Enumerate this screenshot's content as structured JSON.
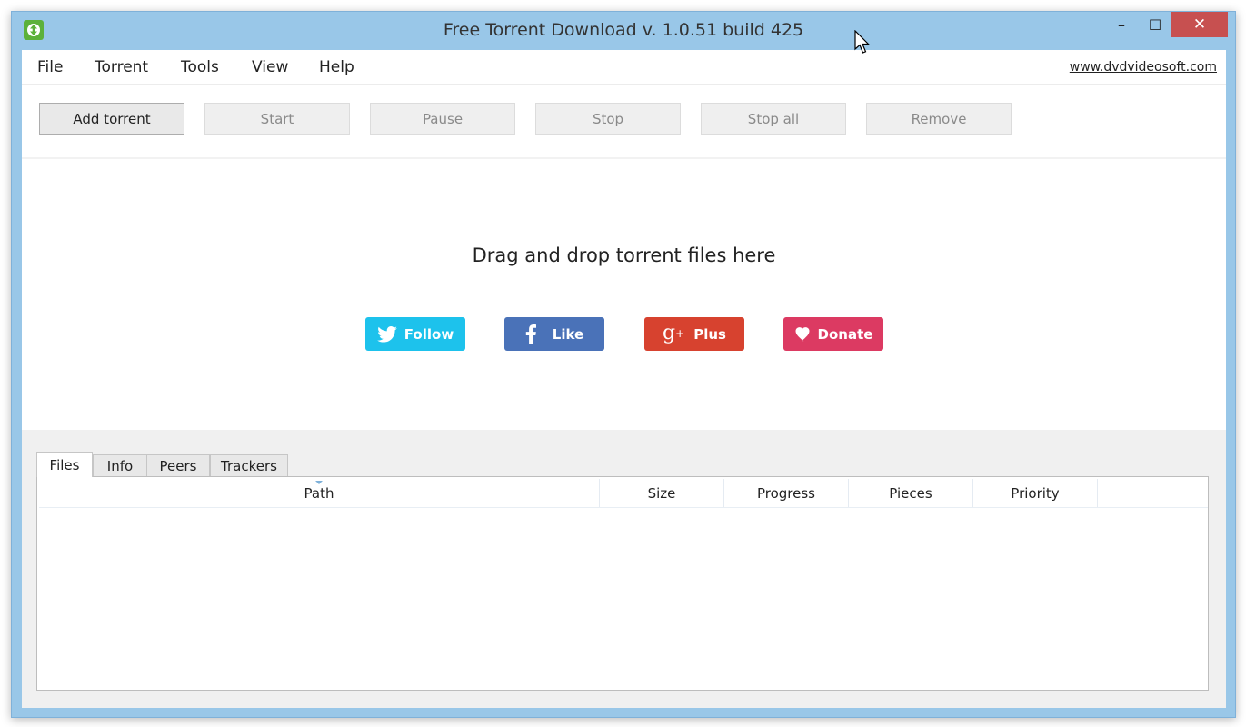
{
  "window": {
    "title": "Free Torrent Download v. 1.0.51 build 425",
    "controls": {
      "minimize": "–",
      "maximize": "☐",
      "close": "✕"
    }
  },
  "menu": {
    "items": [
      "File",
      "Torrent",
      "Tools",
      "View",
      "Help"
    ],
    "site_link": "www.dvdvideosoft.com"
  },
  "toolbar": {
    "buttons": [
      {
        "label": "Add torrent",
        "enabled": true
      },
      {
        "label": "Start",
        "enabled": false
      },
      {
        "label": "Pause",
        "enabled": false
      },
      {
        "label": "Stop",
        "enabled": false
      },
      {
        "label": "Stop all",
        "enabled": false
      },
      {
        "label": "Remove",
        "enabled": false
      }
    ]
  },
  "dropzone": {
    "text": "Drag and drop torrent files here",
    "social": [
      {
        "label": "Follow",
        "icon": "twitter-icon",
        "color": "#1dc2ec"
      },
      {
        "label": "Like",
        "icon": "facebook-icon",
        "color": "#4a72b8"
      },
      {
        "label": "Plus",
        "icon": "google-plus-icon",
        "color": "#d7422f"
      },
      {
        "label": "Donate",
        "icon": "heart-icon",
        "color": "#dc3a62"
      }
    ]
  },
  "details": {
    "tabs": [
      "Files",
      "Info",
      "Peers",
      "Trackers"
    ],
    "selected_tab": "Files",
    "columns": [
      "Path",
      "Size",
      "Progress",
      "Pieces",
      "Priority"
    ],
    "rows": []
  },
  "colors": {
    "frame": "#99c7e8",
    "close_button": "#c75050",
    "app_icon": "#5cb13a"
  }
}
